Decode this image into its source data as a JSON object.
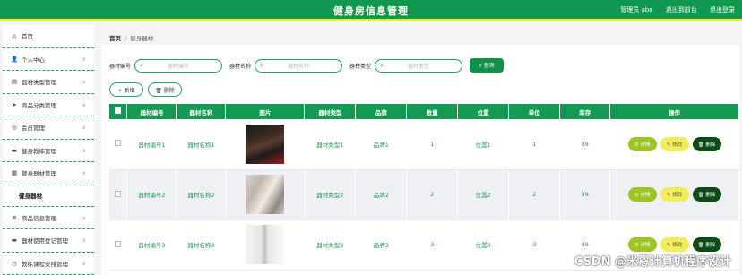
{
  "header": {
    "title": "健身房信息管理",
    "links": [
      "管理员 abo",
      "退出到前台",
      "退出登录"
    ]
  },
  "sidebar": {
    "items": [
      {
        "label": "首页",
        "icon": "home-icon",
        "glyph": "⌂"
      },
      {
        "label": "个人中心",
        "icon": "user-icon",
        "glyph": "👤"
      },
      {
        "label": "器材类型管理",
        "icon": "folder-icon",
        "glyph": "▤"
      },
      {
        "label": "商品分类管理",
        "icon": "send-icon",
        "glyph": "➤"
      },
      {
        "label": "会员管理",
        "icon": "circle-icon",
        "glyph": "◎"
      },
      {
        "label": "健身教练管理",
        "icon": "card-icon",
        "glyph": "▬"
      },
      {
        "label": "健身器材管理",
        "icon": "grid-icon",
        "glyph": "▦"
      }
    ],
    "sub_item": "健身器材",
    "items_after": [
      {
        "label": "商品信息管理",
        "icon": "globe-icon",
        "glyph": "⊕"
      },
      {
        "label": "器材使用登记管理",
        "icon": "card-icon",
        "glyph": "▬"
      },
      {
        "label": "教练课程安排管理",
        "icon": "clock-icon",
        "glyph": "◷"
      }
    ]
  },
  "breadcrumb": {
    "home": "首页",
    "sep": "/",
    "current": "健身器材"
  },
  "search": {
    "fields": [
      {
        "label": "器材编号",
        "placeholder": "器材编号"
      },
      {
        "label": "器材名称",
        "placeholder": "器材名称"
      },
      {
        "label": "器材类型",
        "placeholder": "器材类型"
      }
    ],
    "query_button": "⌕ 查询"
  },
  "actions": {
    "add": "+ 新增",
    "delete": "🗑 删除"
  },
  "table": {
    "headers": [
      "器材编号",
      "器材名称",
      "图片",
      "器材类型",
      "品牌",
      "数量",
      "位置",
      "单位",
      "库存",
      "操作"
    ],
    "rows": [
      [
        "器材编号1",
        "器材名称1",
        "",
        "器材类型1",
        "品牌1",
        "1",
        "位置1",
        "1",
        "99"
      ],
      [
        "器材编号2",
        "器材名称2",
        "",
        "器材类型2",
        "品牌2",
        "2",
        "位置2",
        "2",
        "99"
      ],
      [
        "器材编号3",
        "器材名称3",
        "",
        "器材类型3",
        "品牌3",
        "3",
        "位置3",
        "3",
        "99"
      ]
    ],
    "row_actions": {
      "detail": "☰ 详情",
      "edit": "✎ 修改",
      "delete": "🗑 删除"
    }
  },
  "watermark": "CSDN @米恩计算机程序设计",
  "colors": {
    "primary": "#11984f",
    "accent": "#e9e64a",
    "detail": "#9dc421",
    "edit": "#f1ec58",
    "delete": "#0c4b16"
  }
}
